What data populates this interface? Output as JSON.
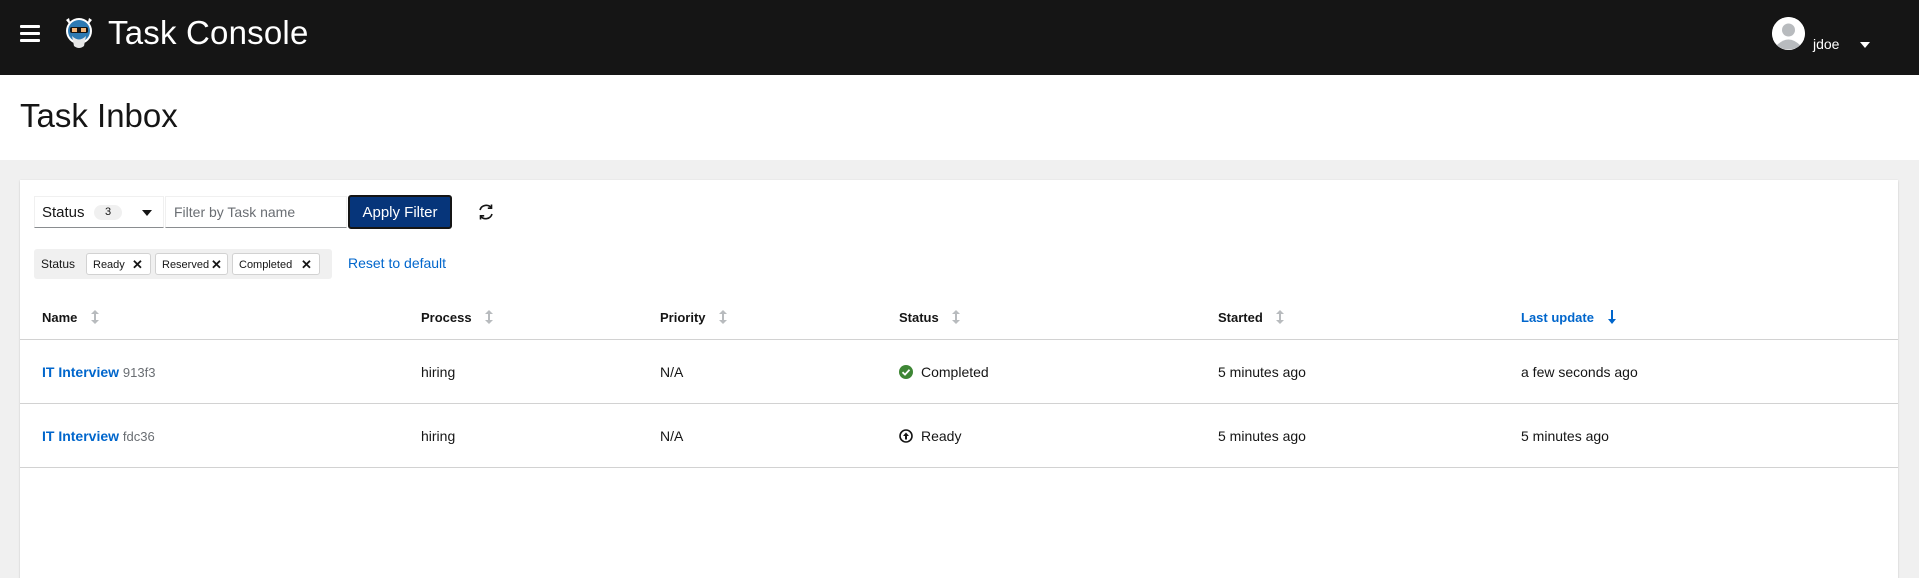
{
  "masthead": {
    "app_title": "Task Console",
    "username": "jdoe"
  },
  "page": {
    "title": "Task Inbox"
  },
  "toolbar": {
    "status_select_label": "Status",
    "status_select_count": "3",
    "filter_placeholder": "Filter by Task name",
    "apply_label": "Apply Filter",
    "chip_group_label": "Status",
    "chips": [
      "Ready",
      "Reserved",
      "Completed"
    ],
    "reset_label": "Reset to default"
  },
  "table": {
    "columns": [
      "Name",
      "Process",
      "Priority",
      "Status",
      "Started",
      "Last update"
    ],
    "sorted_column": "Last update",
    "sort_direction": "descending",
    "rows": [
      {
        "name": "IT Interview",
        "id": "913f3",
        "process": "hiring",
        "priority": "N/A",
        "status": "Completed",
        "started": "5 minutes ago",
        "last_update": "a few seconds ago"
      },
      {
        "name": "IT Interview",
        "id": "fdc36",
        "process": "hiring",
        "priority": "N/A",
        "status": "Ready",
        "started": "5 minutes ago",
        "last_update": "5 minutes ago"
      }
    ]
  },
  "icons": {
    "menu": "hamburger-icon",
    "logo": "kogito-logo",
    "avatar": "user-avatar",
    "refresh": "refresh-icon",
    "sort": "sort-icon",
    "completed": "check-circle-icon",
    "ready": "arrow-circle-icon"
  },
  "colors": {
    "masthead": "#151515",
    "primary_button": "#06357a",
    "link": "#0066cc",
    "success": "#3e8635"
  }
}
